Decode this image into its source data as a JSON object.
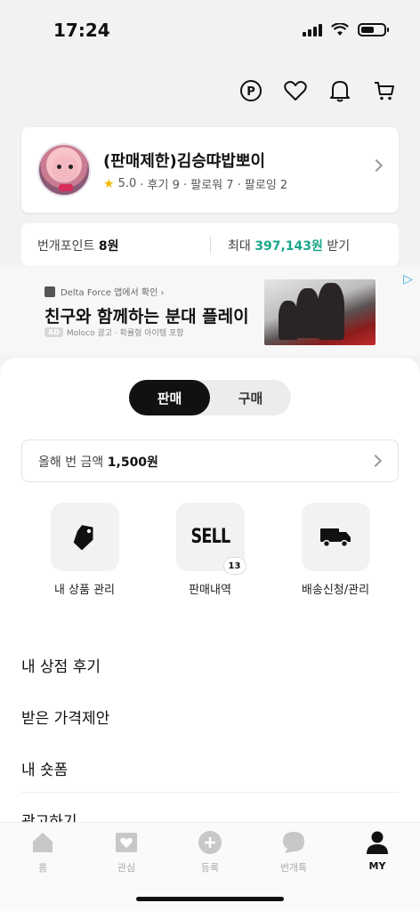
{
  "status": {
    "time": "17:24"
  },
  "profile": {
    "name": "(판매제한)김승땨밥뽀이",
    "rating": "5.0",
    "stats": "· 후기 9 · 팔로워 7 · 팔로잉 2"
  },
  "points": {
    "label": "번개포인트",
    "value": "8원",
    "max_prefix": "최대",
    "max_value": "397,143원",
    "max_suffix": "받기"
  },
  "ad": {
    "brand": "Delta Force 앱에서 확인 ›",
    "headline": "친구와 함께하는 분대 플레이",
    "badge": "AD",
    "sub": "Moloco 광고 · 확률형 아이템 포함"
  },
  "segment": {
    "sell": "판매",
    "buy": "구매",
    "active": "sell"
  },
  "yearly": {
    "label": "올해 번 금액",
    "amount": "1,500원"
  },
  "tiles": [
    {
      "label": "내 상품 관리",
      "icon": "tag-icon"
    },
    {
      "label": "판매내역",
      "icon": "sell-icon",
      "icon_text": "SELL",
      "badge": "13"
    },
    {
      "label": "배송신청/관리",
      "icon": "truck-icon"
    }
  ],
  "menu": [
    "내 상점 후기",
    "받은 가격제안",
    "내 숏폼"
  ],
  "menu_partial": "광고하기",
  "tabs": [
    {
      "label": "홈",
      "icon": "home-icon"
    },
    {
      "label": "관심",
      "icon": "heart-icon"
    },
    {
      "label": "등록",
      "icon": "plus-icon"
    },
    {
      "label": "번개톡",
      "icon": "chat-icon"
    },
    {
      "label": "MY",
      "icon": "person-icon",
      "active": true
    }
  ],
  "colors": {
    "accent_green": "#1aa68a",
    "star": "#f5b800",
    "dark": "#111111"
  }
}
